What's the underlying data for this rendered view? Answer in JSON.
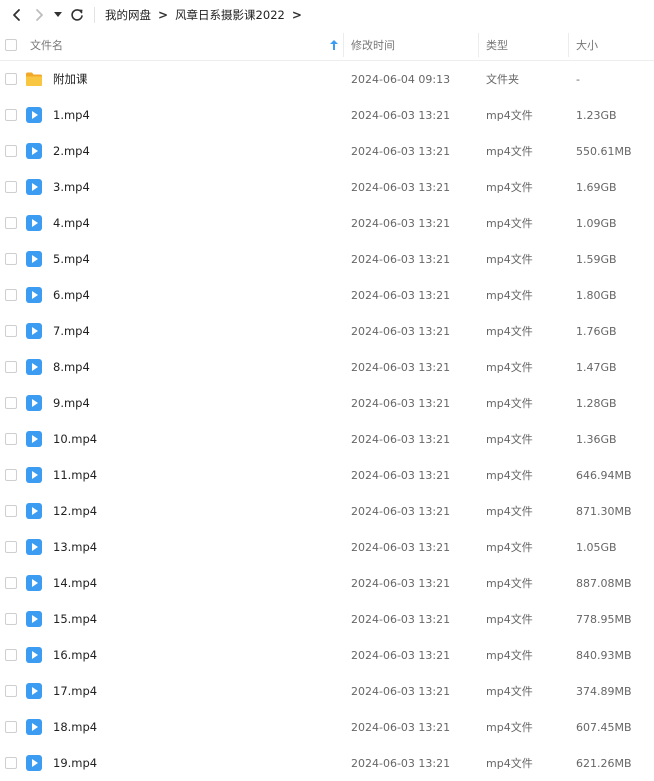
{
  "breadcrumb": [
    "我的网盘",
    "风章日系摄影课2022"
  ],
  "breadcrumb_separator": ">",
  "columns": {
    "name": "文件名",
    "modified": "修改时间",
    "type": "类型",
    "size": "大小"
  },
  "colors": {
    "folder": "#f7c13c",
    "video": "#3b9cf2"
  },
  "files": [
    {
      "name": "附加课",
      "modified": "2024-06-04 09:13",
      "type": "文件夹",
      "size": "-",
      "icon": "folder-icon"
    },
    {
      "name": "1.mp4",
      "modified": "2024-06-03 13:21",
      "type": "mp4文件",
      "size": "1.23GB",
      "icon": "video-file-icon"
    },
    {
      "name": "2.mp4",
      "modified": "2024-06-03 13:21",
      "type": "mp4文件",
      "size": "550.61MB",
      "icon": "video-file-icon"
    },
    {
      "name": "3.mp4",
      "modified": "2024-06-03 13:21",
      "type": "mp4文件",
      "size": "1.69GB",
      "icon": "video-file-icon"
    },
    {
      "name": "4.mp4",
      "modified": "2024-06-03 13:21",
      "type": "mp4文件",
      "size": "1.09GB",
      "icon": "video-file-icon"
    },
    {
      "name": "5.mp4",
      "modified": "2024-06-03 13:21",
      "type": "mp4文件",
      "size": "1.59GB",
      "icon": "video-file-icon"
    },
    {
      "name": "6.mp4",
      "modified": "2024-06-03 13:21",
      "type": "mp4文件",
      "size": "1.80GB",
      "icon": "video-file-icon"
    },
    {
      "name": "7.mp4",
      "modified": "2024-06-03 13:21",
      "type": "mp4文件",
      "size": "1.76GB",
      "icon": "video-file-icon"
    },
    {
      "name": "8.mp4",
      "modified": "2024-06-03 13:21",
      "type": "mp4文件",
      "size": "1.47GB",
      "icon": "video-file-icon"
    },
    {
      "name": "9.mp4",
      "modified": "2024-06-03 13:21",
      "type": "mp4文件",
      "size": "1.28GB",
      "icon": "video-file-icon"
    },
    {
      "name": "10.mp4",
      "modified": "2024-06-03 13:21",
      "type": "mp4文件",
      "size": "1.36GB",
      "icon": "video-file-icon"
    },
    {
      "name": "11.mp4",
      "modified": "2024-06-03 13:21",
      "type": "mp4文件",
      "size": "646.94MB",
      "icon": "video-file-icon"
    },
    {
      "name": "12.mp4",
      "modified": "2024-06-03 13:21",
      "type": "mp4文件",
      "size": "871.30MB",
      "icon": "video-file-icon"
    },
    {
      "name": "13.mp4",
      "modified": "2024-06-03 13:21",
      "type": "mp4文件",
      "size": "1.05GB",
      "icon": "video-file-icon"
    },
    {
      "name": "14.mp4",
      "modified": "2024-06-03 13:21",
      "type": "mp4文件",
      "size": "887.08MB",
      "icon": "video-file-icon"
    },
    {
      "name": "15.mp4",
      "modified": "2024-06-03 13:21",
      "type": "mp4文件",
      "size": "778.95MB",
      "icon": "video-file-icon"
    },
    {
      "name": "16.mp4",
      "modified": "2024-06-03 13:21",
      "type": "mp4文件",
      "size": "840.93MB",
      "icon": "video-file-icon"
    },
    {
      "name": "17.mp4",
      "modified": "2024-06-03 13:21",
      "type": "mp4文件",
      "size": "374.89MB",
      "icon": "video-file-icon"
    },
    {
      "name": "18.mp4",
      "modified": "2024-06-03 13:21",
      "type": "mp4文件",
      "size": "607.45MB",
      "icon": "video-file-icon"
    },
    {
      "name": "19.mp4",
      "modified": "2024-06-03 13:21",
      "type": "mp4文件",
      "size": "621.26MB",
      "icon": "video-file-icon"
    }
  ]
}
